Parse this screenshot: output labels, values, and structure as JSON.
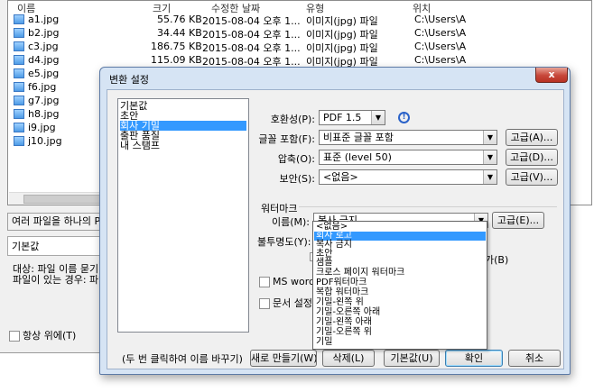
{
  "file_window": {
    "columns": [
      "이름",
      "크기",
      "수정한 날짜",
      "유형",
      "위치"
    ],
    "files": [
      {
        "name": "a1.jpg",
        "size": "55.76 KB",
        "date": "2015-08-04 오후 1...",
        "type": "이미지(jpg) 파일",
        "location": "C:\\Users\\A"
      },
      {
        "name": "b2.jpg",
        "size": "34.44 KB",
        "date": "2015-08-04 오후 1...",
        "type": "이미지(jpg) 파일",
        "location": "C:\\Users\\A"
      },
      {
        "name": "c3.jpg",
        "size": "186.75 KB",
        "date": "2015-08-04 오후 1...",
        "type": "이미지(jpg) 파일",
        "location": "C:\\Users\\A"
      },
      {
        "name": "d4.jpg",
        "size": "115.09 KB",
        "date": "2015-08-04 오후 1...",
        "type": "이미지(jpg) 파일",
        "location": "C:\\Users\\A"
      },
      {
        "name": "e5.jpg"
      },
      {
        "name": "f6.jpg"
      },
      {
        "name": "g7.jpg"
      },
      {
        "name": "h8.jpg"
      },
      {
        "name": "i9.jpg"
      },
      {
        "name": "j10.jpg"
      }
    ],
    "merge_button": "여러 파일을 하나의 PDF",
    "profile_value": "기본값",
    "target_text": "대상: 파일 이름 묻기",
    "exists_text": "파일이 있는 경우: 파일",
    "always_on_top": "항상 위에(T)"
  },
  "dialog": {
    "title": "변환 설정",
    "close": "x",
    "profiles": [
      "기본값",
      "초안",
      "회사 기밀",
      "출판 품질",
      "내 스탬프"
    ],
    "selected_profile": "회사 기밀",
    "compat_label": "호환성(P):",
    "compat_value": "PDF 1.5",
    "font_label": "글꼴 포함(F):",
    "font_value": "비표준 글꼴 포함",
    "compress_label": "압축(O):",
    "compress_value": "표준 (level 50)",
    "security_label": "보안(S):",
    "security_value": "<없음>",
    "advanced_a": "고급(A)...",
    "advanced_d": "고급(D)...",
    "advanced_v": "고급(V)...",
    "watermark_legend": "워터마크",
    "wm_name_label": "이름(M):",
    "wm_name_value": "복사 금지",
    "advanced_e": "고급(E)...",
    "opacity_label": "불투명도(Y):",
    "partial_b": "가(B)",
    "ms_word_check": "MS word 변",
    "doc_settings_check": "문서 설정(",
    "rename_hint": "(두 번 클릭하여 이름 바꾸기)",
    "new_button": "새로 만들기(W)",
    "delete_button": "삭제(L)",
    "default_button": "기본값(U)",
    "ok_button": "확인",
    "cancel_button": "취소"
  },
  "watermark_options": [
    "<없음>",
    "회사 로고",
    "복사 금지",
    "초안",
    "샘플",
    "크로스 페이지 워터마크",
    "PDF워터마크",
    "복합 워터마크",
    "기밀-왼쪽 위",
    "기밀-오른쪽 아래",
    "기밀-왼쪽 아래",
    "기밀-오른쪽 위",
    "기밀"
  ],
  "selected_watermark_option": "회사 로고",
  "icons": {
    "info": "info-icon",
    "file": "image-file-icon",
    "dropdown": "chevron-down-icon"
  },
  "colors": {
    "selection": "#3399ff",
    "title_bar": "#d6e4f4",
    "close_button": "#c7473a"
  }
}
